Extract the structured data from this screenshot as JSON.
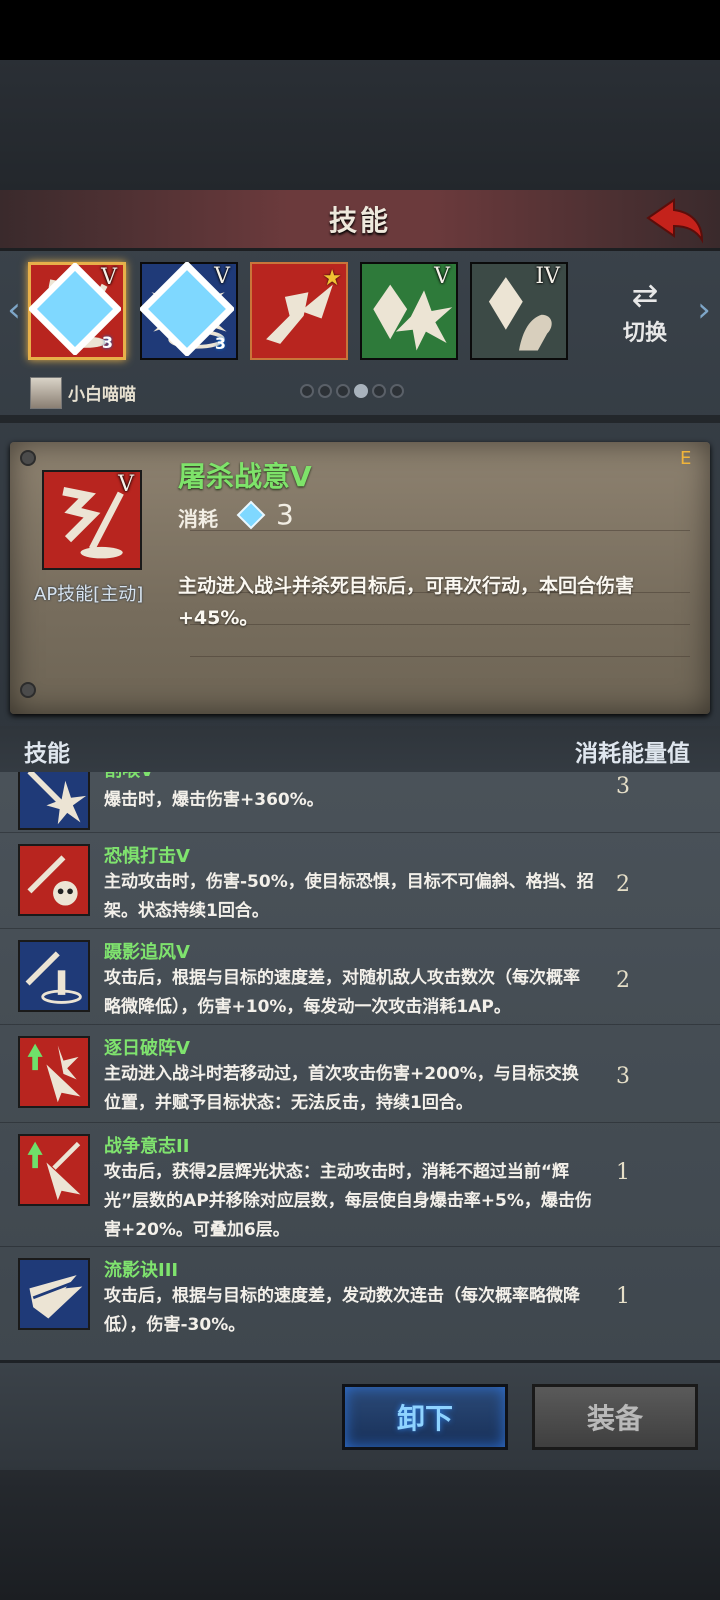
{
  "header": {
    "title": "技能"
  },
  "slots": [
    {
      "name": "屠杀战意",
      "level": "V",
      "gem": "3",
      "color": "#b8251f",
      "selected": true
    },
    {
      "name": "spirit-burst",
      "level": "V",
      "gem": "3",
      "color": "#1f3a78",
      "selected": false
    },
    {
      "name": "charge",
      "level": "",
      "star": "★",
      "color": "#b8251f",
      "selected": false
    },
    {
      "name": "shard-burst",
      "level": "V",
      "gem": "",
      "color": "#2e7a3a",
      "selected": false
    },
    {
      "name": "crystal-hand",
      "level": "IV",
      "gem": "",
      "color": "#3c4a46",
      "selected": false
    }
  ],
  "switch": {
    "label": "切换",
    "icon": "⇄"
  },
  "owner": {
    "name": "小白喵喵"
  },
  "pagination": {
    "total": 6,
    "active": 4
  },
  "detail": {
    "name": "屠杀战意V",
    "level": "V",
    "cost_label": "消耗",
    "cost_value": "3",
    "type": "AP技能[主动]",
    "grade": "E",
    "description": "主动进入战斗并杀死目标后，可再次行动，本回合伤害+45%。"
  },
  "list_header": {
    "left": "技能",
    "right": "消耗能量值"
  },
  "skills": [
    {
      "name": "割喉V",
      "desc": "爆击时，爆击伤害+360%。",
      "cost": "3",
      "color": "#1f3a78"
    },
    {
      "name": "恐惧打击V",
      "desc": "主动攻击时，伤害-50%，使目标恐惧，目标不可偏斜、格挡、招架。状态持续1回合。",
      "cost": "2",
      "color": "#b8251f"
    },
    {
      "name": "蹑影追风V",
      "desc": "攻击后，根据与目标的速度差，对随机敌人攻击数次（每次概率略微降低），伤害+10%，每发动一次攻击消耗1AP。",
      "cost": "2",
      "color": "#1f3a78"
    },
    {
      "name": "逐日破阵V",
      "desc": "主动进入战斗时若移动过，首次攻击伤害+200%，与目标交换位置，并赋予目标状态：无法反击，持续1回合。",
      "cost": "3",
      "color": "#b8251f"
    },
    {
      "name": "战争意志II",
      "desc": "攻击后，获得2层辉光状态：主动攻击时，消耗不超过当前“辉光”层数的AP并移除对应层数，每层使自身爆击率+5%，爆击伤害+20%。可叠加6层。",
      "cost": "1",
      "color": "#b8251f"
    },
    {
      "name": "流影诀III",
      "desc": "攻击后，根据与目标的速度差，发动数次连击（每次概率略微降低），伤害-30%。",
      "cost": "1",
      "color": "#1f3a78"
    }
  ],
  "buttons": {
    "unequip": "卸下",
    "equip": "装备"
  }
}
